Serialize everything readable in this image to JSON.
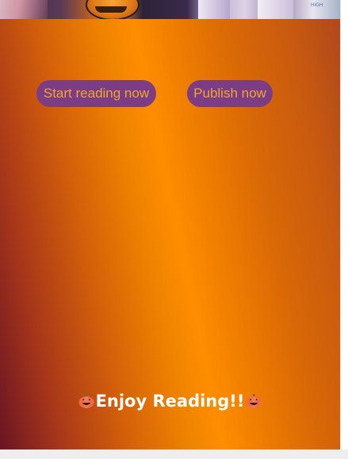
{
  "banner": {
    "image_icon": "halloween-banner-image",
    "corner_text": "HIGH"
  },
  "actions": {
    "start_reading_label": "Start reading now",
    "publish_label": "Publish now"
  },
  "footer_message": {
    "text": "Enjoy Reading!!",
    "icon": "jack-o-lantern-icon"
  },
  "colors": {
    "button_bg": "#7c3d84",
    "button_text": "#f0a72b",
    "gradient_dark": "#6a1424",
    "gradient_bright": "#ff8d00"
  }
}
